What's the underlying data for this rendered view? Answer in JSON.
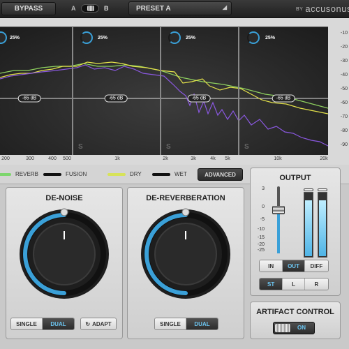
{
  "topbar": {
    "bypass_label": "BYPASS",
    "ab_a": "A",
    "ab_b": "B",
    "preset_label": "PRESET A",
    "brand_by": "BY",
    "brand_name": "accusonus"
  },
  "spectrum": {
    "bands": [
      {
        "amount": "25%",
        "threshold": "-65 dB"
      },
      {
        "amount": "25%",
        "threshold": "-65 dB"
      },
      {
        "amount": "25%",
        "threshold": "-65 dB"
      },
      {
        "amount": "25%",
        "threshold": "-65 dB"
      }
    ],
    "solo_label": "S",
    "y_ticks": [
      "-10",
      "-20",
      "-30",
      "-40",
      "-50",
      "-60",
      "-70",
      "-80",
      "-90"
    ],
    "x_ticks": [
      "200",
      "300",
      "400",
      "500",
      "1k",
      "2k",
      "3k",
      "4k",
      "5k",
      "10k",
      "20k"
    ]
  },
  "legend": {
    "reverb": "REVERB",
    "fusion": "FUSION",
    "dry": "DRY",
    "wet": "WET",
    "advanced_label": "ADVANCED",
    "colors": {
      "reverb": "#7dd66d",
      "fusion": "#111111",
      "dry": "#d7e35a",
      "wet": "#111111"
    }
  },
  "denoise": {
    "title": "DE-NOISE",
    "single": "SINGLE",
    "dual": "DUAL",
    "adapt": "ADAPT",
    "knob_level": 0.5
  },
  "dereverb": {
    "title": "DE-REVERBERATION",
    "single": "SINGLE",
    "dual": "DUAL",
    "knob_level": 0.5
  },
  "output": {
    "title": "OUTPUT",
    "scale": [
      "3",
      "0",
      "-5",
      "-10",
      "-15",
      "-20",
      "-25"
    ],
    "monitor": [
      "IN",
      "OUT",
      "DIFF"
    ],
    "channels": [
      "ST",
      "L",
      "R"
    ]
  },
  "artifact": {
    "title": "ARTIFACT CONTROL",
    "toggle_label": "ON"
  },
  "colors": {
    "accent": "#3aa0d8",
    "dry_line": "#e5e34a",
    "wet_line": "#8a58e0",
    "reverb_line": "#8fd25f"
  }
}
